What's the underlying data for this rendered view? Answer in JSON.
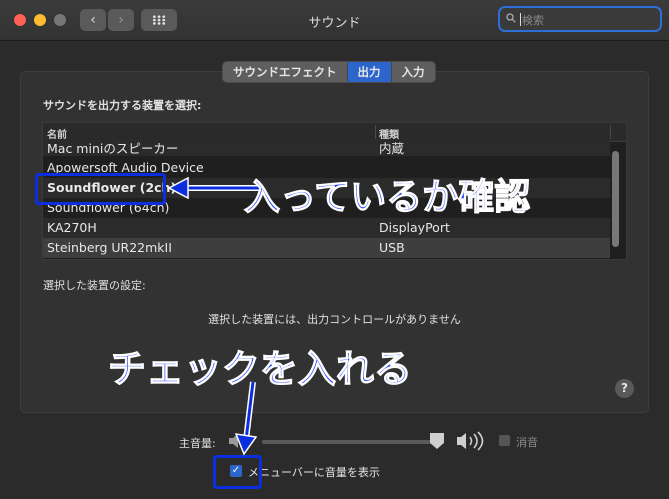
{
  "window": {
    "title": "サウンド"
  },
  "nav": {
    "back": "‹",
    "forward": "›"
  },
  "search": {
    "placeholder": "検索"
  },
  "tabs": [
    {
      "label": "サウンドエフェクト",
      "active": false
    },
    {
      "label": "出力",
      "active": true
    },
    {
      "label": "入力",
      "active": false
    }
  ],
  "output": {
    "select_label": "サウンドを出力する装置を選択:",
    "columns": {
      "name": "名前",
      "type": "種類"
    },
    "rows": [
      {
        "name": "Mac miniのスピーカー",
        "type": "内蔵"
      },
      {
        "name": "Apowersoft Audio Device",
        "type": ""
      },
      {
        "name": "Soundflower (2ch)",
        "type": ""
      },
      {
        "name": "Soundflower (64ch)",
        "type": ""
      },
      {
        "name": "KA270H",
        "type": "DisplayPort"
      },
      {
        "name": "Steinberg UR22mkII",
        "type": "USB"
      }
    ],
    "selected_index": 5,
    "device_settings_label": "選択した装置の設定:",
    "no_controls_message": "選択した装置には、出力コントロールがありません"
  },
  "help": {
    "label": "?"
  },
  "volume": {
    "label": "主音量:",
    "level": 1.0,
    "mute_label": "消音",
    "muted": false
  },
  "menubar_option": {
    "label": "メニューバーに音量を表示",
    "checked": true,
    "check_glyph": "✓"
  },
  "annotations": {
    "verify_text": "入っているか確認",
    "check_text": "チェックを入れる"
  },
  "colors": {
    "accent": "#2c66cc",
    "annotation": "#1d3bff"
  }
}
